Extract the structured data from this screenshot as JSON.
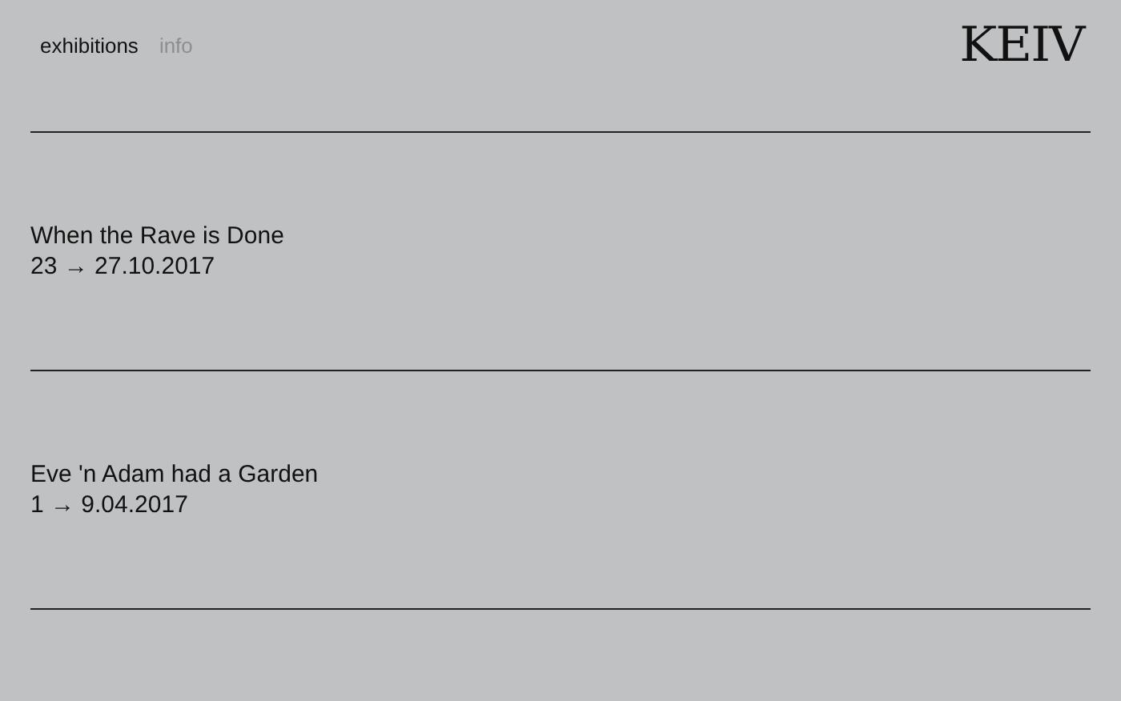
{
  "nav": [
    {
      "label": "exhibitions",
      "selected": true
    },
    {
      "label": "info",
      "selected": false
    }
  ],
  "logo": "KEIV",
  "exhibitions": [
    {
      "title": "When the Rave is Done",
      "dates": "23 → 27.10.2017"
    },
    {
      "title": "Eve 'n Adam had a Garden",
      "dates": "1 → 9.04.2017"
    }
  ]
}
